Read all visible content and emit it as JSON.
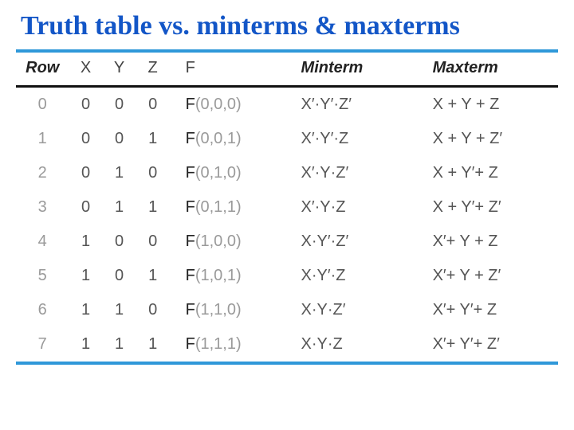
{
  "title": "Truth table vs. minterms & maxterms",
  "headers": {
    "row": "Row",
    "x": "X",
    "y": "Y",
    "z": "Z",
    "f": "F",
    "minterm": "Minterm",
    "maxterm": "Maxterm"
  },
  "rows": [
    {
      "n": "0",
      "x": "0",
      "y": "0",
      "z": "0",
      "F_prefix": "F",
      "F_args": "(0,0,0)",
      "min": "X′·Y′·Z′",
      "max": "X + Y + Z"
    },
    {
      "n": "1",
      "x": "0",
      "y": "0",
      "z": "1",
      "F_prefix": "F",
      "F_args": "(0,0,1)",
      "min": "X′·Y′·Z",
      "max": "X + Y + Z′"
    },
    {
      "n": "2",
      "x": "0",
      "y": "1",
      "z": "0",
      "F_prefix": "F",
      "F_args": "(0,1,0)",
      "min": "X′·Y·Z′",
      "max": "X + Y′+ Z"
    },
    {
      "n": "3",
      "x": "0",
      "y": "1",
      "z": "1",
      "F_prefix": "F",
      "F_args": "(0,1,1)",
      "min": "X′·Y·Z",
      "max": "X + Y′+ Z′"
    },
    {
      "n": "4",
      "x": "1",
      "y": "0",
      "z": "0",
      "F_prefix": "F",
      "F_args": "(1,0,0)",
      "min": "X·Y′·Z′",
      "max": "X′+ Y + Z"
    },
    {
      "n": "5",
      "x": "1",
      "y": "0",
      "z": "1",
      "F_prefix": "F",
      "F_args": "(1,0,1)",
      "min": "X·Y′·Z",
      "max": "X′+ Y + Z′"
    },
    {
      "n": "6",
      "x": "1",
      "y": "1",
      "z": "0",
      "F_prefix": "F",
      "F_args": "(1,1,0)",
      "min": "X·Y·Z′",
      "max": "X′+ Y′+ Z"
    },
    {
      "n": "7",
      "x": "1",
      "y": "1",
      "z": "1",
      "F_prefix": "F",
      "F_args": "(1,1,1)",
      "min": "X·Y·Z",
      "max": "X′+ Y′+ Z′"
    }
  ]
}
